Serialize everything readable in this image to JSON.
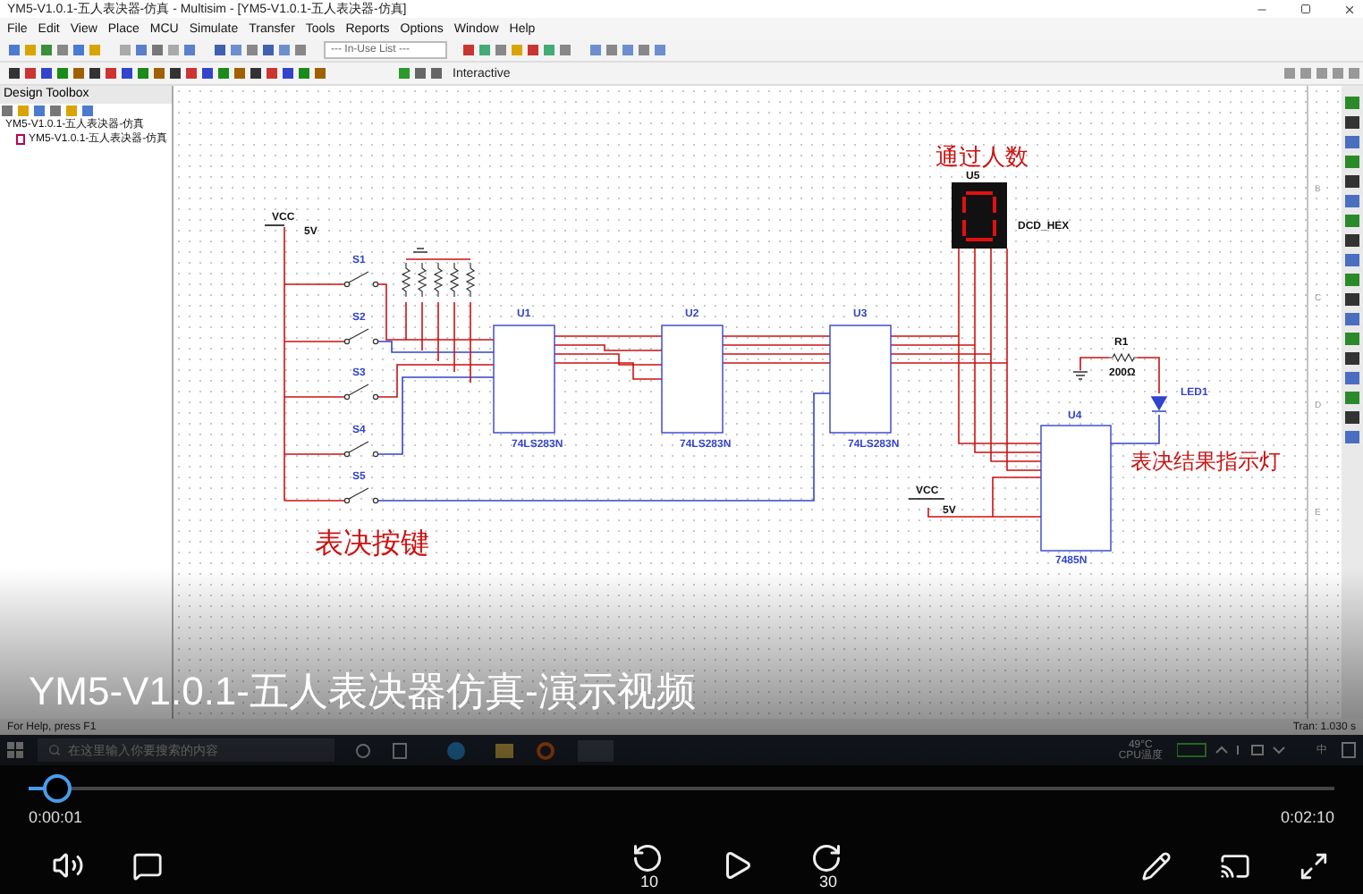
{
  "window": {
    "title": "YM5-V1.0.1-五人表决器-仿真 - Multisim - [YM5-V1.0.1-五人表决器-仿真]"
  },
  "menu": [
    "File",
    "Edit",
    "View",
    "Place",
    "MCU",
    "Simulate",
    "Transfer",
    "Tools",
    "Reports",
    "Options",
    "Window",
    "Help"
  ],
  "toolbar": {
    "in_use_list": "--- In-Use List ---",
    "mode": "Interactive"
  },
  "design_toolbox": {
    "title": "Design Toolbox",
    "tree": [
      {
        "label": "YM5-V1.0.1-五人表决器-仿真",
        "children": [
          {
            "label": "YM5-V1.0.1-五人表决器-仿真"
          }
        ]
      }
    ]
  },
  "schematic": {
    "supplies": [
      {
        "label": "VCC",
        "value": "5V"
      },
      {
        "label": "VCC",
        "value": "5V"
      }
    ],
    "switches": [
      "S1",
      "S2",
      "S3",
      "S4",
      "S5"
    ],
    "adders": [
      {
        "ref": "U1",
        "part": "74LS283N"
      },
      {
        "ref": "U2",
        "part": "74LS283N"
      },
      {
        "ref": "U3",
        "part": "74LS283N"
      }
    ],
    "display": {
      "ref": "U5",
      "part": "DCD_HEX"
    },
    "resistor": {
      "ref": "R1",
      "value": "200Ω"
    },
    "led": {
      "ref": "LED1"
    },
    "comparator": {
      "ref": "U4",
      "part": "7485N"
    },
    "notes": [
      "通过人数",
      "表决按键",
      "表决结果指示灯"
    ],
    "border_rows": [
      "B",
      "C",
      "D",
      "E"
    ]
  },
  "caption": "YM5-V1.0.1-五人表决器仿真-演示视频",
  "status_bar": {
    "help": "For Help, press F1",
    "sim_time": "Tran: 1.030 s"
  },
  "taskbar": {
    "search_placeholder": "在这里输入你要搜索的内容",
    "temperature": "49°C",
    "temperature_label": "CPU温度",
    "ime": "中"
  },
  "player": {
    "progress": {
      "level": 0.022
    },
    "elapsed": "0:00:01",
    "duration": "0:02:10",
    "skip_back": "10",
    "skip_forward": "30"
  }
}
